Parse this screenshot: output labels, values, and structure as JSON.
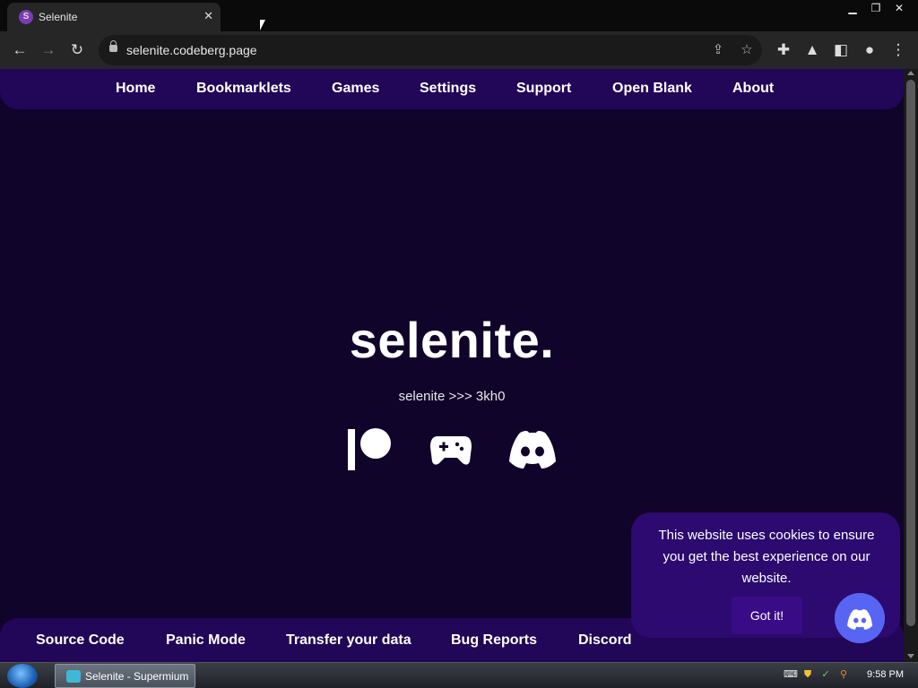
{
  "browser": {
    "tab": {
      "favicon_letter": "S",
      "title": "Selenite"
    },
    "url": "selenite.codeberg.page"
  },
  "page": {
    "top_nav": [
      "Home",
      "Bookmarklets",
      "Games",
      "Settings",
      "Support",
      "Open Blank",
      "About"
    ],
    "hero_title": "selenite.",
    "hero_subtitle": "selenite >>> 3kh0",
    "social_icons": [
      "patreon-icon",
      "gamepad-icon",
      "discord-icon"
    ],
    "bottom_nav": [
      "Source Code",
      "Panic Mode",
      "Transfer your data",
      "Bug Reports",
      "Discord"
    ],
    "cookie": {
      "message": "This website uses cookies to ensure you get the best experience on our website.",
      "button": "Got it!"
    },
    "colors": {
      "background": "#10042a",
      "nav_background": "#220657",
      "cookie_background": "#2c0a6f",
      "discord_blue": "#5865f2"
    }
  },
  "taskbar": {
    "window_label": "Selenite - Supermium",
    "clock": "9:58 PM"
  }
}
